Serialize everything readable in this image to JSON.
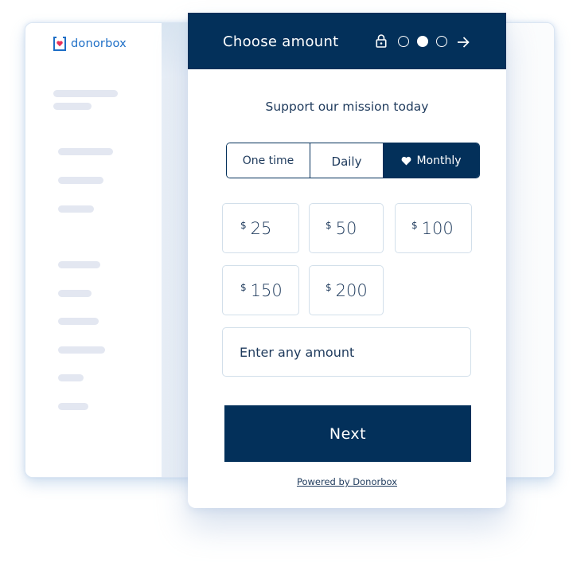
{
  "brand": {
    "logo_text": "donorbox",
    "logo_icon": "donorbox-box-heart-icon",
    "brand_color": "#1d6ec6",
    "heart_color": "#e8305a"
  },
  "theme": {
    "primary": "#03305a",
    "border": "#d2dfea",
    "skeleton": "#e3e7f1"
  },
  "form": {
    "header": {
      "title": "Choose amount",
      "lock_icon": "lock-icon",
      "steps": [
        {
          "state": "inactive"
        },
        {
          "state": "active"
        },
        {
          "state": "inactive"
        }
      ],
      "next_icon": "arrow-right-icon"
    },
    "subtitle": "Support our mission today",
    "frequency": {
      "options": [
        {
          "label": "One time",
          "selected": false
        },
        {
          "label": "Daily",
          "selected": false
        },
        {
          "label": "Monthly",
          "selected": true,
          "icon": "heart-icon"
        }
      ]
    },
    "amounts": [
      {
        "currency": "$",
        "value": "25"
      },
      {
        "currency": "$",
        "value": "50"
      },
      {
        "currency": "$",
        "value": "100"
      },
      {
        "currency": "$",
        "value": "150"
      },
      {
        "currency": "$",
        "value": "200"
      }
    ],
    "custom_amount": {
      "placeholder": "Enter any amount",
      "value": ""
    },
    "next_label": "Next",
    "powered_by": "Powered by Donorbox"
  }
}
